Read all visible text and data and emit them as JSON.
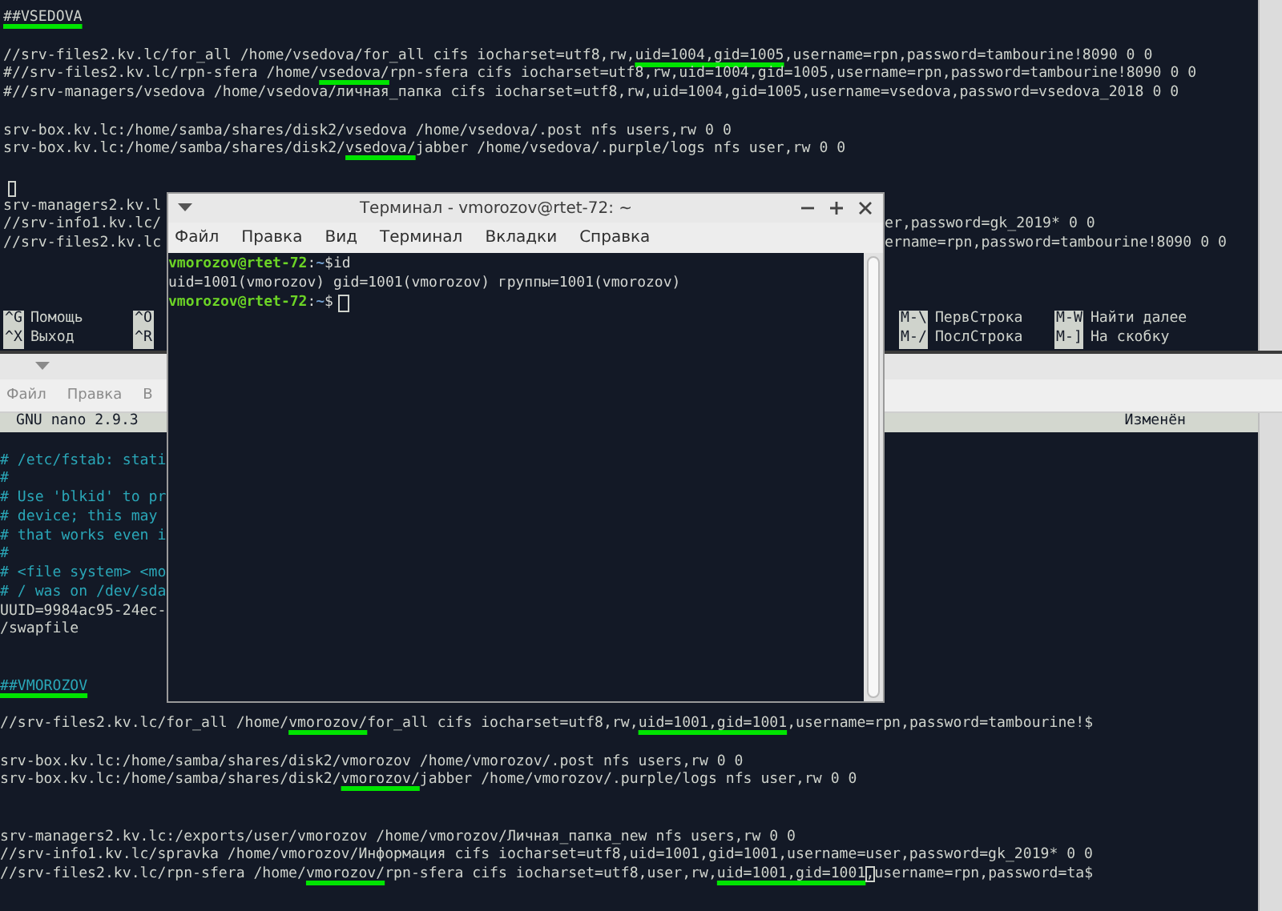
{
  "top_window": {
    "lines": [
      {
        "kind": "line",
        "comment": false,
        "segments": [
          {
            "text": "##VSEDOVA",
            "underlined": true
          }
        ]
      },
      {
        "kind": "blank"
      },
      {
        "kind": "line",
        "comment": false,
        "segments": [
          {
            "text": "//srv-files2.kv.lc/for_all /home/vsedova/for_all cifs iocharset=utf8,rw,",
            "underlined": false
          },
          {
            "text": "uid=1004,gid=1005",
            "underlined": true
          },
          {
            "text": ",username=rpn,password=tambourine!8090 0 0",
            "underlined": false
          }
        ]
      },
      {
        "kind": "line",
        "comment": false,
        "segments": [
          {
            "text": "#//srv-files2.kv.lc/rpn-sfera /home/",
            "underlined": false
          },
          {
            "text": "vsedova/",
            "underlined": true
          },
          {
            "text": "rpn-sfera cifs iocharset=utf8,rw,uid=1004,gid=1005,username=rpn,password=tambourine!8090 0 0",
            "underlined": false
          }
        ]
      },
      {
        "kind": "line",
        "comment": false,
        "segments": [
          {
            "text": "#//srv-managers/vsedova /home/vsedova/личная_папка cifs iocharset=utf8,rw,uid=1004,gid=1005,username=vsedova,password=vsedova_2018 0 0",
            "underlined": false
          }
        ]
      },
      {
        "kind": "blank"
      },
      {
        "kind": "line",
        "comment": false,
        "segments": [
          {
            "text": "srv-box.kv.lc:/home/samba/shares/disk2/vsedova /home/vsedova/.post nfs users,rw 0 0",
            "underlined": false
          }
        ]
      },
      {
        "kind": "line",
        "comment": false,
        "segments": [
          {
            "text": "srv-box.kv.lc:/home/samba/shares/disk2/",
            "underlined": false
          },
          {
            "text": "vsedova/",
            "underlined": true
          },
          {
            "text": "jabber /home/vsedova/.purple/logs nfs user,rw 0 0",
            "underlined": false
          }
        ]
      },
      {
        "kind": "blank"
      },
      {
        "kind": "cursor"
      },
      {
        "kind": "split",
        "comment": false,
        "left": "srv-managers2.kv.l"
      },
      {
        "kind": "split",
        "comment": false,
        "left": "//srv-info1.kv.lc/",
        "right": "er,password=gk_2019* 0 0"
      },
      {
        "kind": "split",
        "comment": false,
        "left": "//srv-files2.kv.lc",
        "right": "ername=rpn,password=tambourine!8090 0 0"
      },
      {
        "kind": "blank"
      },
      {
        "kind": "blank"
      },
      {
        "kind": "blank"
      },
      {
        "kind": "shortcuts",
        "left": [
          {
            "key": "^G",
            "label": "Помощь"
          },
          {
            "key": "^O"
          }
        ],
        "right": [
          {
            "key": "M-\\",
            "label": "ПервСтрока"
          },
          {
            "key": "M-W",
            "label": "Найти далее"
          }
        ]
      },
      {
        "kind": "shortcuts",
        "left": [
          {
            "key": "^X",
            "label": "Выход"
          },
          {
            "key": "^R"
          }
        ],
        "right": [
          {
            "key": "M-/",
            "label": "ПослСтрока"
          },
          {
            "key": "M-]",
            "label": "На скобку"
          }
        ]
      }
    ]
  },
  "bottom_window": {
    "menu": [
      "Файл",
      "Правка",
      "В"
    ],
    "header": {
      "left": "GNU nano 2.9.3",
      "right": "Изменён"
    },
    "lines": [
      {
        "kind": "blank"
      },
      {
        "kind": "split",
        "comment": true,
        "left": "# /etc/fstab: stati"
      },
      {
        "kind": "split",
        "comment": true,
        "left": "#"
      },
      {
        "kind": "split",
        "comment": true,
        "left": "# Use 'blkid' to pr"
      },
      {
        "kind": "split",
        "comment": true,
        "left": "# device; this may"
      },
      {
        "kind": "split",
        "comment": true,
        "left": "# that works even i"
      },
      {
        "kind": "split",
        "comment": true,
        "left": "#"
      },
      {
        "kind": "split",
        "comment": true,
        "left": "# <file system> <mo"
      },
      {
        "kind": "split",
        "comment": true,
        "left": "# / was on /dev/sda"
      },
      {
        "kind": "split",
        "comment": false,
        "left": "UUID=9984ac95-24ec-"
      },
      {
        "kind": "split",
        "comment": false,
        "left": "/swapfile"
      },
      {
        "kind": "blank"
      },
      {
        "kind": "blank"
      },
      {
        "kind": "line",
        "comment": true,
        "segments": [
          {
            "text": "##VMOROZOV",
            "underlined": true
          }
        ]
      },
      {
        "kind": "blank"
      },
      {
        "kind": "line",
        "comment": false,
        "segments": [
          {
            "text": "//srv-files2.kv.lc/for_all /home/",
            "underlined": false
          },
          {
            "text": "vmorozov/",
            "underlined": true
          },
          {
            "text": "for_all cifs iocharset=utf8,rw,",
            "underlined": false
          },
          {
            "text": "uid=1001,gid=1001",
            "underlined": true
          },
          {
            "text": ",username=rpn,password=tambourine!$",
            "underlined": false
          }
        ]
      },
      {
        "kind": "blank"
      },
      {
        "kind": "line",
        "comment": false,
        "segments": [
          {
            "text": "srv-box.kv.lc:/home/samba/shares/disk2/vmorozov /home/vmorozov/.post nfs users,rw 0 0",
            "underlined": false
          }
        ]
      },
      {
        "kind": "line",
        "comment": false,
        "segments": [
          {
            "text": "srv-box.kv.lc:/home/samba/shares/disk2/",
            "underlined": false
          },
          {
            "text": "vmorozov/",
            "underlined": true
          },
          {
            "text": "jabber /home/vmorozov/.purple/logs nfs user,rw 0 0",
            "underlined": false
          }
        ]
      },
      {
        "kind": "blank"
      },
      {
        "kind": "blank"
      },
      {
        "kind": "line",
        "comment": false,
        "segments": [
          {
            "text": "srv-managers2.kv.lc:/exports/user/vmorozov /home/vmorozov/Личная_папка_new nfs users,rw 0 0",
            "underlined": false
          }
        ]
      },
      {
        "kind": "line",
        "comment": false,
        "segments": [
          {
            "text": "//srv-info1.kv.lc/spravka /home/vmorozov/Информация cifs iocharset=utf8,uid=1001,gid=1001,username=user,password=gk_2019* 0 0",
            "underlined": false
          }
        ]
      },
      {
        "kind": "line",
        "comment": false,
        "segments": [
          {
            "text": "//srv-files2.kv.lc/rpn-sfera /home/",
            "underlined": false,
            "cursor": false
          },
          {
            "text": "vmorozov/",
            "underlined": true,
            "cursor": false
          },
          {
            "text": "rpn-sfera cifs iocharset=utf8,user,rw,",
            "underlined": false,
            "cursor": false
          },
          {
            "text": "uid=1001,gid=1001",
            "underlined": true,
            "cursor": false
          },
          {
            "text": ",username=rpn,password=ta$",
            "underlined": false,
            "cursor": true
          }
        ]
      }
    ]
  },
  "terminal": {
    "title": "Терминал - vmorozov@rtet-72: ~",
    "menu": [
      "Файл",
      "Правка",
      "Вид",
      "Терминал",
      "Вкладки",
      "Справка"
    ],
    "lines": [
      {
        "kind": "prompt",
        "user": "vmorozov@rtet-72",
        "separator": ":",
        "path": "~",
        "symbol": "$",
        "command": "id",
        "cursor": false
      },
      {
        "kind": "output",
        "text": "uid=1001(vmorozov) gid=1001(vmorozov) группы=1001(vmorozov)"
      },
      {
        "kind": "prompt",
        "user": "vmorozov@rtet-72",
        "separator": ":",
        "path": "~",
        "symbol": "$",
        "cursor": true
      }
    ]
  }
}
